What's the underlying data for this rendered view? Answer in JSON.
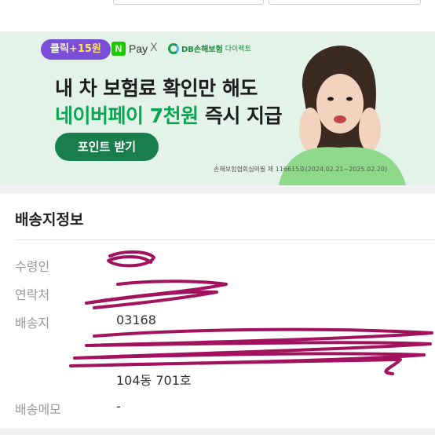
{
  "banner": {
    "click_badge_prefix": "클릭",
    "click_badge_amount": "+15원",
    "npay_logo": "N",
    "npay_label": "Pay",
    "times_symbol": "X",
    "partner_name": "DB손해보험",
    "partner_sub": "다이렉트",
    "headline_line1": "내 차 보험료 확인만 해도",
    "headline_line2_accent": "네이버페이 7천원",
    "headline_line2_rest": " 즉시 지급",
    "cta_label": "포인트 받기",
    "disclaimer": "손해보험협회심의필 제 116615호(2024.02.21~2025.02.20)",
    "accent_color": "#06a750",
    "cta_color": "#1a7e4c",
    "background_color": "#e3f3e9"
  },
  "shipping": {
    "title": "배송지정보",
    "recipient_label": "수령인",
    "contact_label": "연락처",
    "address_label": "배송지",
    "postal_code": "03168",
    "address_detail": "104동 701호",
    "memo_label": "배송메모",
    "memo_value": "-"
  },
  "redaction_color": "#a3125e"
}
